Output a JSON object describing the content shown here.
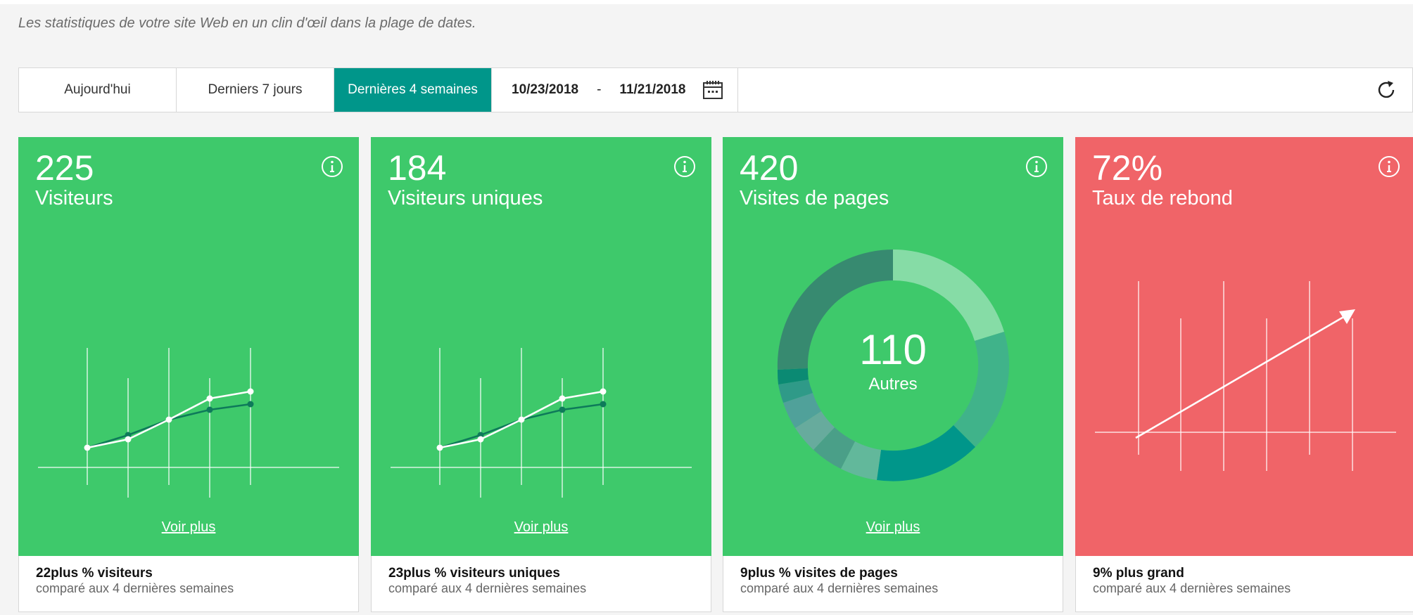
{
  "header": {
    "subtitle": "Les statistiques de votre site Web en un clin d'œil dans la plage de dates."
  },
  "toolbar": {
    "ranges": [
      {
        "label": "Aujourd'hui",
        "active": false
      },
      {
        "label": "Derniers 7 jours",
        "active": false
      },
      {
        "label": "Dernières 4 semaines",
        "active": true
      }
    ],
    "date_from": "10/23/2018",
    "date_separator": "-",
    "date_to": "11/21/2018",
    "calendar_icon": "calendar-icon",
    "refresh_icon": "refresh-icon"
  },
  "colors": {
    "accent": "#00968a",
    "card_green": "#3ec96b",
    "card_red": "#f06468",
    "series_dark": "#0e7a5a",
    "series_light": "#ffffff"
  },
  "cards": [
    {
      "value": "225",
      "label": "Visiteurs",
      "more": "Voir plus",
      "footer_bold": "22plus % visiteurs",
      "footer_text": "comparé aux 4 dernières semaines",
      "info_icon": "info-icon"
    },
    {
      "value": "184",
      "label": "Visiteurs uniques",
      "more": "Voir plus",
      "footer_bold": "23plus % visiteurs uniques",
      "footer_text": "comparé aux 4 dernières semaines",
      "info_icon": "info-icon"
    },
    {
      "value": "420",
      "label": "Visites de pages",
      "more": "Voir plus",
      "donut_value": "110",
      "donut_label": "Autres",
      "footer_bold": "9plus % visites de pages",
      "footer_text": "comparé aux 4 dernières semaines",
      "info_icon": "info-icon"
    },
    {
      "value": "72%",
      "label": "Taux de rebond",
      "footer_bold": "9% plus grand",
      "footer_text": "comparé aux 4 dernières semaines",
      "info_icon": "info-icon"
    }
  ]
}
